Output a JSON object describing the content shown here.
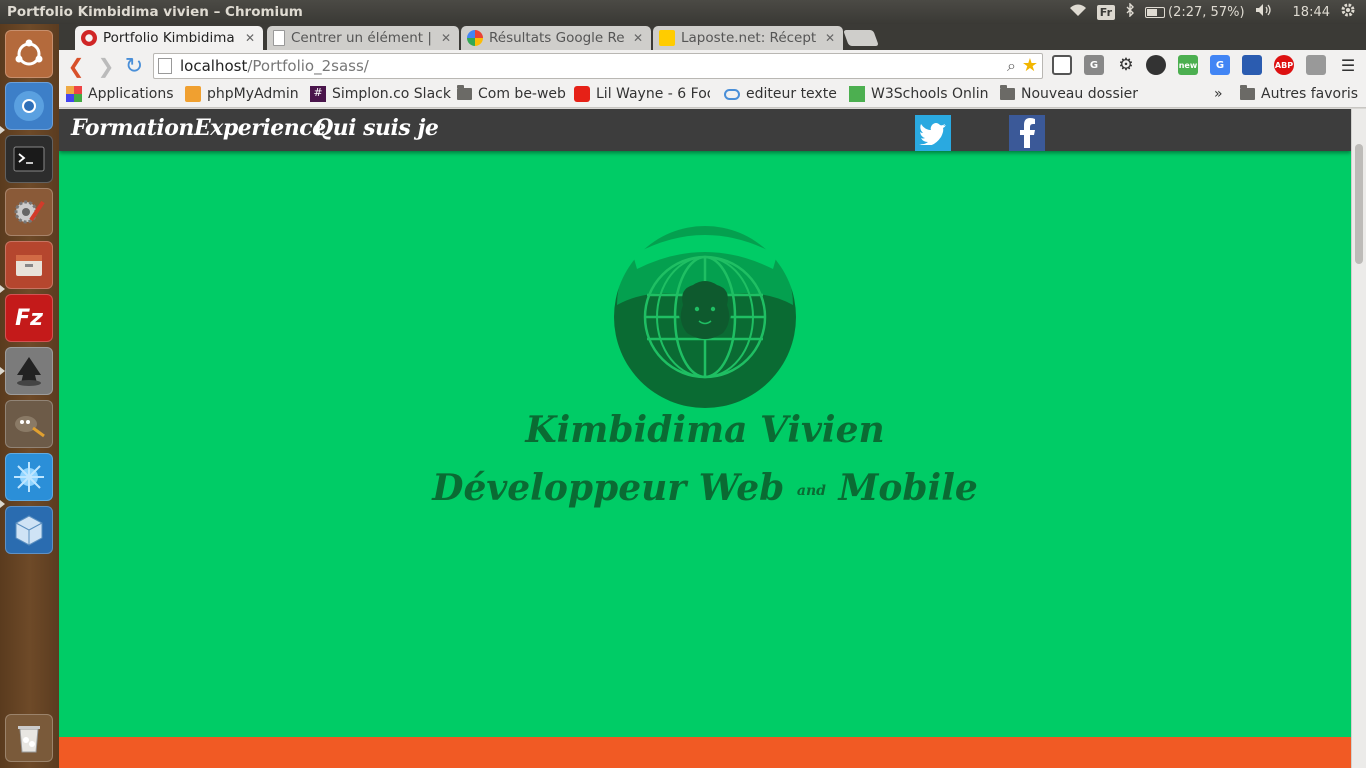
{
  "system": {
    "window_title": "Portfolio Kimbidima vivien – Chromium",
    "keyboard_layout": "Fr",
    "battery": "(2:27, 57%)",
    "clock": "18:44"
  },
  "launcher": {
    "apps": [
      "ubuntu-dash",
      "chromium",
      "terminal",
      "system-settings",
      "files",
      "filezilla",
      "inkscape",
      "gimp",
      "app-blue-splash",
      "virtualbox",
      "trash"
    ]
  },
  "browser": {
    "tabs": [
      {
        "title": "Portfolio Kimbidima vivien",
        "active": true
      },
      {
        "title": "Centrer un élément |",
        "active": false
      },
      {
        "title": "Résultats Google Re",
        "active": false
      },
      {
        "title": "Laposte.net: Récept",
        "active": false
      }
    ],
    "url": {
      "host": "localhost",
      "path": "/Portfolio_2sass/"
    },
    "bookmarks": [
      {
        "label": "Applications"
      },
      {
        "label": "phpMyAdmin"
      },
      {
        "label": "Simplon.co Slack"
      },
      {
        "label": "Com be-web"
      },
      {
        "label": "Lil Wayne - 6 Foo"
      },
      {
        "label": "editeur texte"
      },
      {
        "label": "W3Schools Onlin"
      },
      {
        "label": "Nouveau dossier"
      }
    ],
    "overflow_chevron": "»",
    "other_bookmarks": "Autres favoris"
  },
  "page": {
    "nav": {
      "formation": "Formation",
      "experience": "Experience",
      "about": "Qui suis je"
    },
    "hero": {
      "name": "Kimbidima Vivien",
      "role_start": "Développeur Web",
      "role_and": "and",
      "role_end": "Mobile"
    },
    "colors": {
      "background": "#00cc66",
      "nav": "#3d3d3d",
      "logo": "#0a6b33",
      "footer_band": "#f15a24",
      "twitter": "#2aa9e0",
      "facebook": "#3b5998"
    }
  }
}
